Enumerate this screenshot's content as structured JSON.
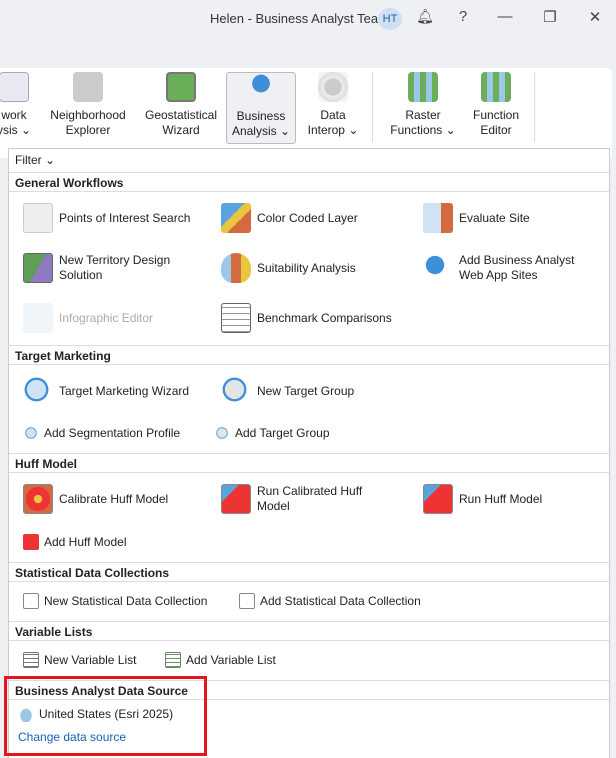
{
  "titlebar": {
    "user": "Helen - Business Analyst Team",
    "avatar": "HT",
    "help": "?",
    "minimize": "—",
    "restore": "❐",
    "close": "✕",
    "bell": "🔔"
  },
  "ribbon": [
    {
      "label": "work\nysis ⌄"
    },
    {
      "label": "Neighborhood\nExplorer"
    },
    {
      "label": "Geostatistical\nWizard"
    },
    {
      "label": "Business\nAnalysis ⌄"
    },
    {
      "label": "Data\nInterop ⌄"
    },
    {
      "label": "Raster\nFunctions ⌄"
    },
    {
      "label": "Function\nEditor"
    }
  ],
  "filter": "Filter ⌄",
  "sections": {
    "general": {
      "title": "General Workflows",
      "items": [
        "Points of Interest Search",
        "Color Coded Layer",
        "Evaluate Site",
        "New Territory Design Solution",
        "Suitability Analysis",
        "Add Business Analyst Web App Sites",
        "Infographic Editor",
        "Benchmark Comparisons"
      ]
    },
    "target": {
      "title": "Target Marketing",
      "items": [
        "Target Marketing Wizard",
        "New Target Group",
        "Add Segmentation Profile",
        "Add Target Group"
      ]
    },
    "huff": {
      "title": "Huff Model",
      "items": [
        "Calibrate Huff Model",
        "Run Calibrated Huff Model",
        "Run Huff Model",
        "Add Huff Model"
      ]
    },
    "stat": {
      "title": "Statistical Data Collections",
      "items": [
        "New Statistical Data Collection",
        "Add Statistical Data Collection"
      ]
    },
    "vars": {
      "title": "Variable Lists",
      "items": [
        "New Variable List",
        "Add Variable List"
      ]
    },
    "source": {
      "title": "Business Analyst Data Source",
      "current": "United States (Esri 2025)",
      "change": "Change data source"
    }
  },
  "colors": {
    "accent": "#1a5fb4",
    "highlight": "#e8141c"
  }
}
